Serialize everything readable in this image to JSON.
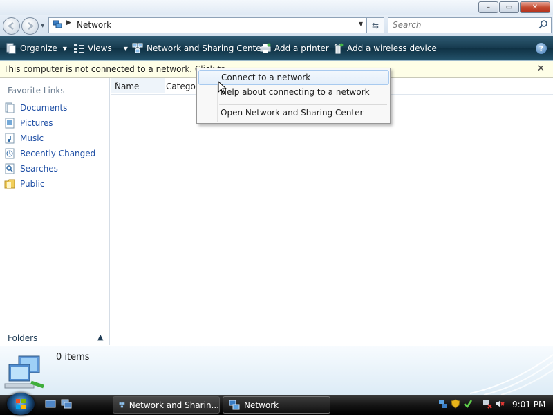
{
  "window": {
    "address": "Network",
    "search_placeholder": "Search"
  },
  "toolbar": {
    "organize": "Organize",
    "views": "Views",
    "network_sharing_center": "Network and Sharing Center",
    "add_printer": "Add a printer",
    "add_wireless": "Add a wireless device"
  },
  "infobar": {
    "text": "This computer is not connected to a network. Click to"
  },
  "nav": {
    "favorite_links_title": "Favorite Links",
    "items": [
      {
        "label": "Documents"
      },
      {
        "label": "Pictures"
      },
      {
        "label": "Music"
      },
      {
        "label": "Recently Changed"
      },
      {
        "label": "Searches"
      },
      {
        "label": "Public"
      }
    ],
    "folders_label": "Folders"
  },
  "columns": {
    "name": "Name",
    "category": "Catego"
  },
  "context_menu": {
    "items": [
      {
        "label": "Connect to a network"
      },
      {
        "label": "Help about connecting to a network"
      },
      {
        "label": "Open Network and Sharing Center"
      }
    ]
  },
  "details": {
    "count": "0 items"
  },
  "taskbar": {
    "buttons": [
      {
        "label": "Network and Sharin..."
      },
      {
        "label": "Network"
      }
    ],
    "clock": "9:01 PM"
  }
}
